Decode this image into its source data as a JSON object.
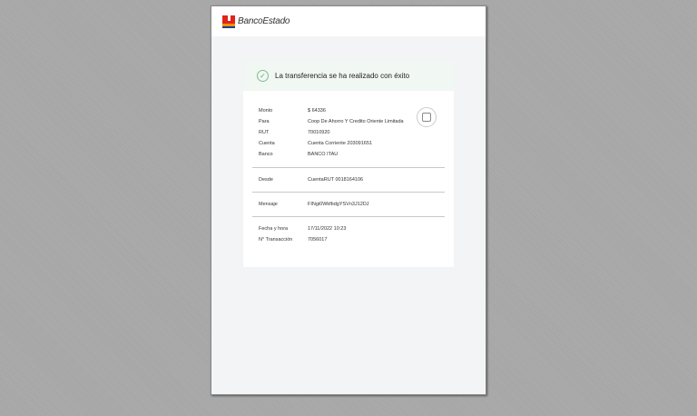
{
  "header": {
    "brand": "BancoEstado"
  },
  "success": {
    "message": "La transferencia se ha realizado con éxito"
  },
  "details": [
    {
      "label": "Monto",
      "value": "$ 64336"
    },
    {
      "label": "Para",
      "value": "Coop De Ahorro Y Credito Oriente Limitada"
    },
    {
      "label": "RUT",
      "value": "70010920"
    },
    {
      "label": "Cuenta",
      "value": "Cuenta Corriente 203091651"
    },
    {
      "label": "Banco",
      "value": "BANCO ITAU"
    }
  ],
  "from": {
    "label": "Desde",
    "value": "CuentaRUT 0018164106"
  },
  "message": {
    "label": "Mensaje",
    "value": "FINgi0WkfbdgYSVn3J12DJ"
  },
  "meta": [
    {
      "label": "Fecha y hora",
      "value": "17/11/2022 10:23"
    },
    {
      "label": "N° Transacción",
      "value": "7056017"
    }
  ],
  "colors": {
    "success": "#5bb070",
    "logo_red": "#e2231a",
    "logo_orange": "#f39200",
    "logo_blue": "#1d3f8f"
  }
}
